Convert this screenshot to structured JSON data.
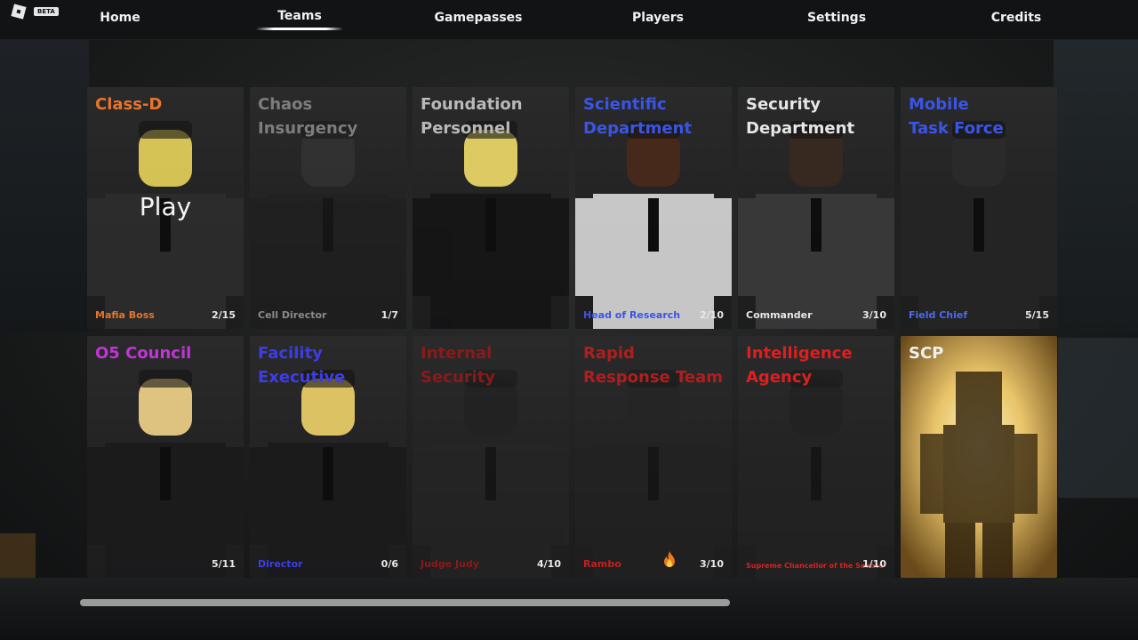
{
  "topbar": {
    "beta_label": "BETA",
    "nav": [
      {
        "label": "Home"
      },
      {
        "label": "Teams"
      },
      {
        "label": "Gamepasses"
      },
      {
        "label": "Players"
      },
      {
        "label": "Settings"
      },
      {
        "label": "Credits"
      }
    ],
    "active_tab": "Teams"
  },
  "teams": [
    {
      "title": "Class-D",
      "title_color": "#e8742a",
      "role": "Mafia Boss",
      "role_color": "#e8742a",
      "count": "2/15",
      "play_label": "Play",
      "skin": "#e9d45a",
      "outfit": "#2d2d2e"
    },
    {
      "title": "Chaos\nInsurgency",
      "title_color": "#7d7d7d",
      "role": "Cell Director",
      "role_color": "#8a8a8a",
      "count": "1/7",
      "skin": "#3a3a3a",
      "outfit": "#1f1f20"
    },
    {
      "title": "Foundation\nPersonnel",
      "title_color": "#b9b9b9",
      "role": "",
      "role_color": "#b9b9b9",
      "count": "",
      "skin": "#f1dc6a",
      "outfit": "#151516"
    },
    {
      "title": "Scientific\nDepartment",
      "title_color": "#3a55e6",
      "role": "Head of Research",
      "role_color": "#3a55e6",
      "count": "2/10",
      "skin": "#4a2a1a",
      "outfit": "#d9d9d9"
    },
    {
      "title": "Security\nDepartment",
      "title_color": "#e6e6e6",
      "role": "Commander",
      "role_color": "#e6e6e6",
      "count": "3/10",
      "skin": "#3a2a20",
      "outfit": "#3b3b3c"
    },
    {
      "title": "Mobile\nTask Force",
      "title_color": "#3a55e6",
      "role": "Field Chief",
      "role_color": "#4a6af0",
      "count": "5/15",
      "skin": "#2b2b2b",
      "outfit": "#252526"
    },
    {
      "title": "O5 Council",
      "title_color": "#c035d6",
      "role": "",
      "role_color": "#c035d6",
      "count": "5/11",
      "skin": "#f3d58a",
      "outfit": "#1b1b1c"
    },
    {
      "title": "Facility\nExecutive",
      "title_color": "#3d3de8",
      "role": "Director",
      "role_color": "#3d3de8",
      "count": "0/6",
      "skin": "#f1d36a",
      "outfit": "#1b1b1c"
    },
    {
      "title": "Internal\nSecurity",
      "title_color": "#8a1a1a",
      "role": "Judge Judy",
      "role_color": "#8a1a1a",
      "count": "4/10",
      "skin": "#202020",
      "outfit": "#262627"
    },
    {
      "title": "Rapid\nResponse Team",
      "title_color": "#b01e1e",
      "role": "Rambo",
      "role_color": "#c02020",
      "count": "3/10",
      "skin": "#252525",
      "outfit": "#222223"
    },
    {
      "title": "Intelligence\nAgency",
      "title_color": "#e01e1e",
      "role": "Supreme Chancellor of the Senate",
      "role_color": "#e01e1e",
      "count": "1/10",
      "skin": "#202020",
      "outfit": "#242425"
    },
    {
      "title": "SCP",
      "title_color": "#f0f0f0",
      "role": "",
      "role_color": "#f0f0f0",
      "count": "",
      "skin": "#3a2a10",
      "outfit": "#3a2a10"
    }
  ],
  "icons": {
    "fire": "fire-icon",
    "roblox": "roblox-logo-icon"
  },
  "scrollbar": {
    "position": 0.0
  }
}
